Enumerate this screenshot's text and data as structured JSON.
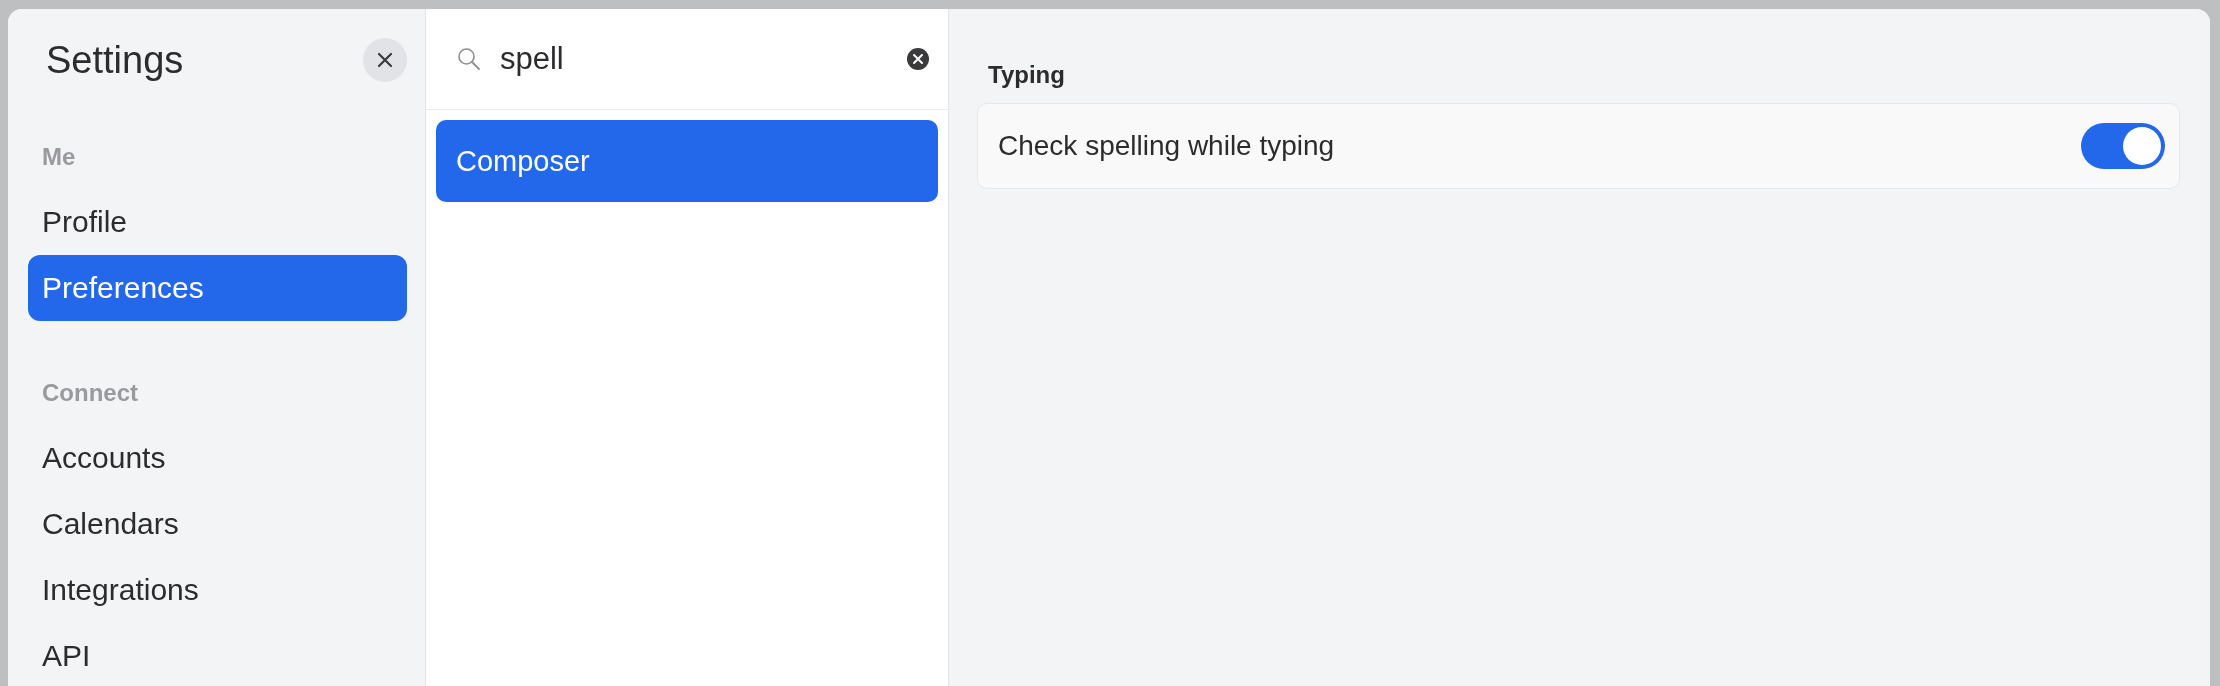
{
  "sidebar": {
    "title": "Settings",
    "sections": [
      {
        "heading": "Me",
        "items": [
          {
            "label": "Profile",
            "selected": false
          },
          {
            "label": "Preferences",
            "selected": true
          }
        ]
      },
      {
        "heading": "Connect",
        "items": [
          {
            "label": "Accounts",
            "selected": false
          },
          {
            "label": "Calendars",
            "selected": false
          },
          {
            "label": "Integrations",
            "selected": false
          },
          {
            "label": "API",
            "selected": false
          }
        ]
      }
    ]
  },
  "search": {
    "value": "spell"
  },
  "results": [
    {
      "label": "Composer",
      "selected": true
    }
  ],
  "panel": {
    "heading": "Typing",
    "settings": [
      {
        "kind": "toggle",
        "label": "Check spelling while typing",
        "on": true
      }
    ]
  }
}
